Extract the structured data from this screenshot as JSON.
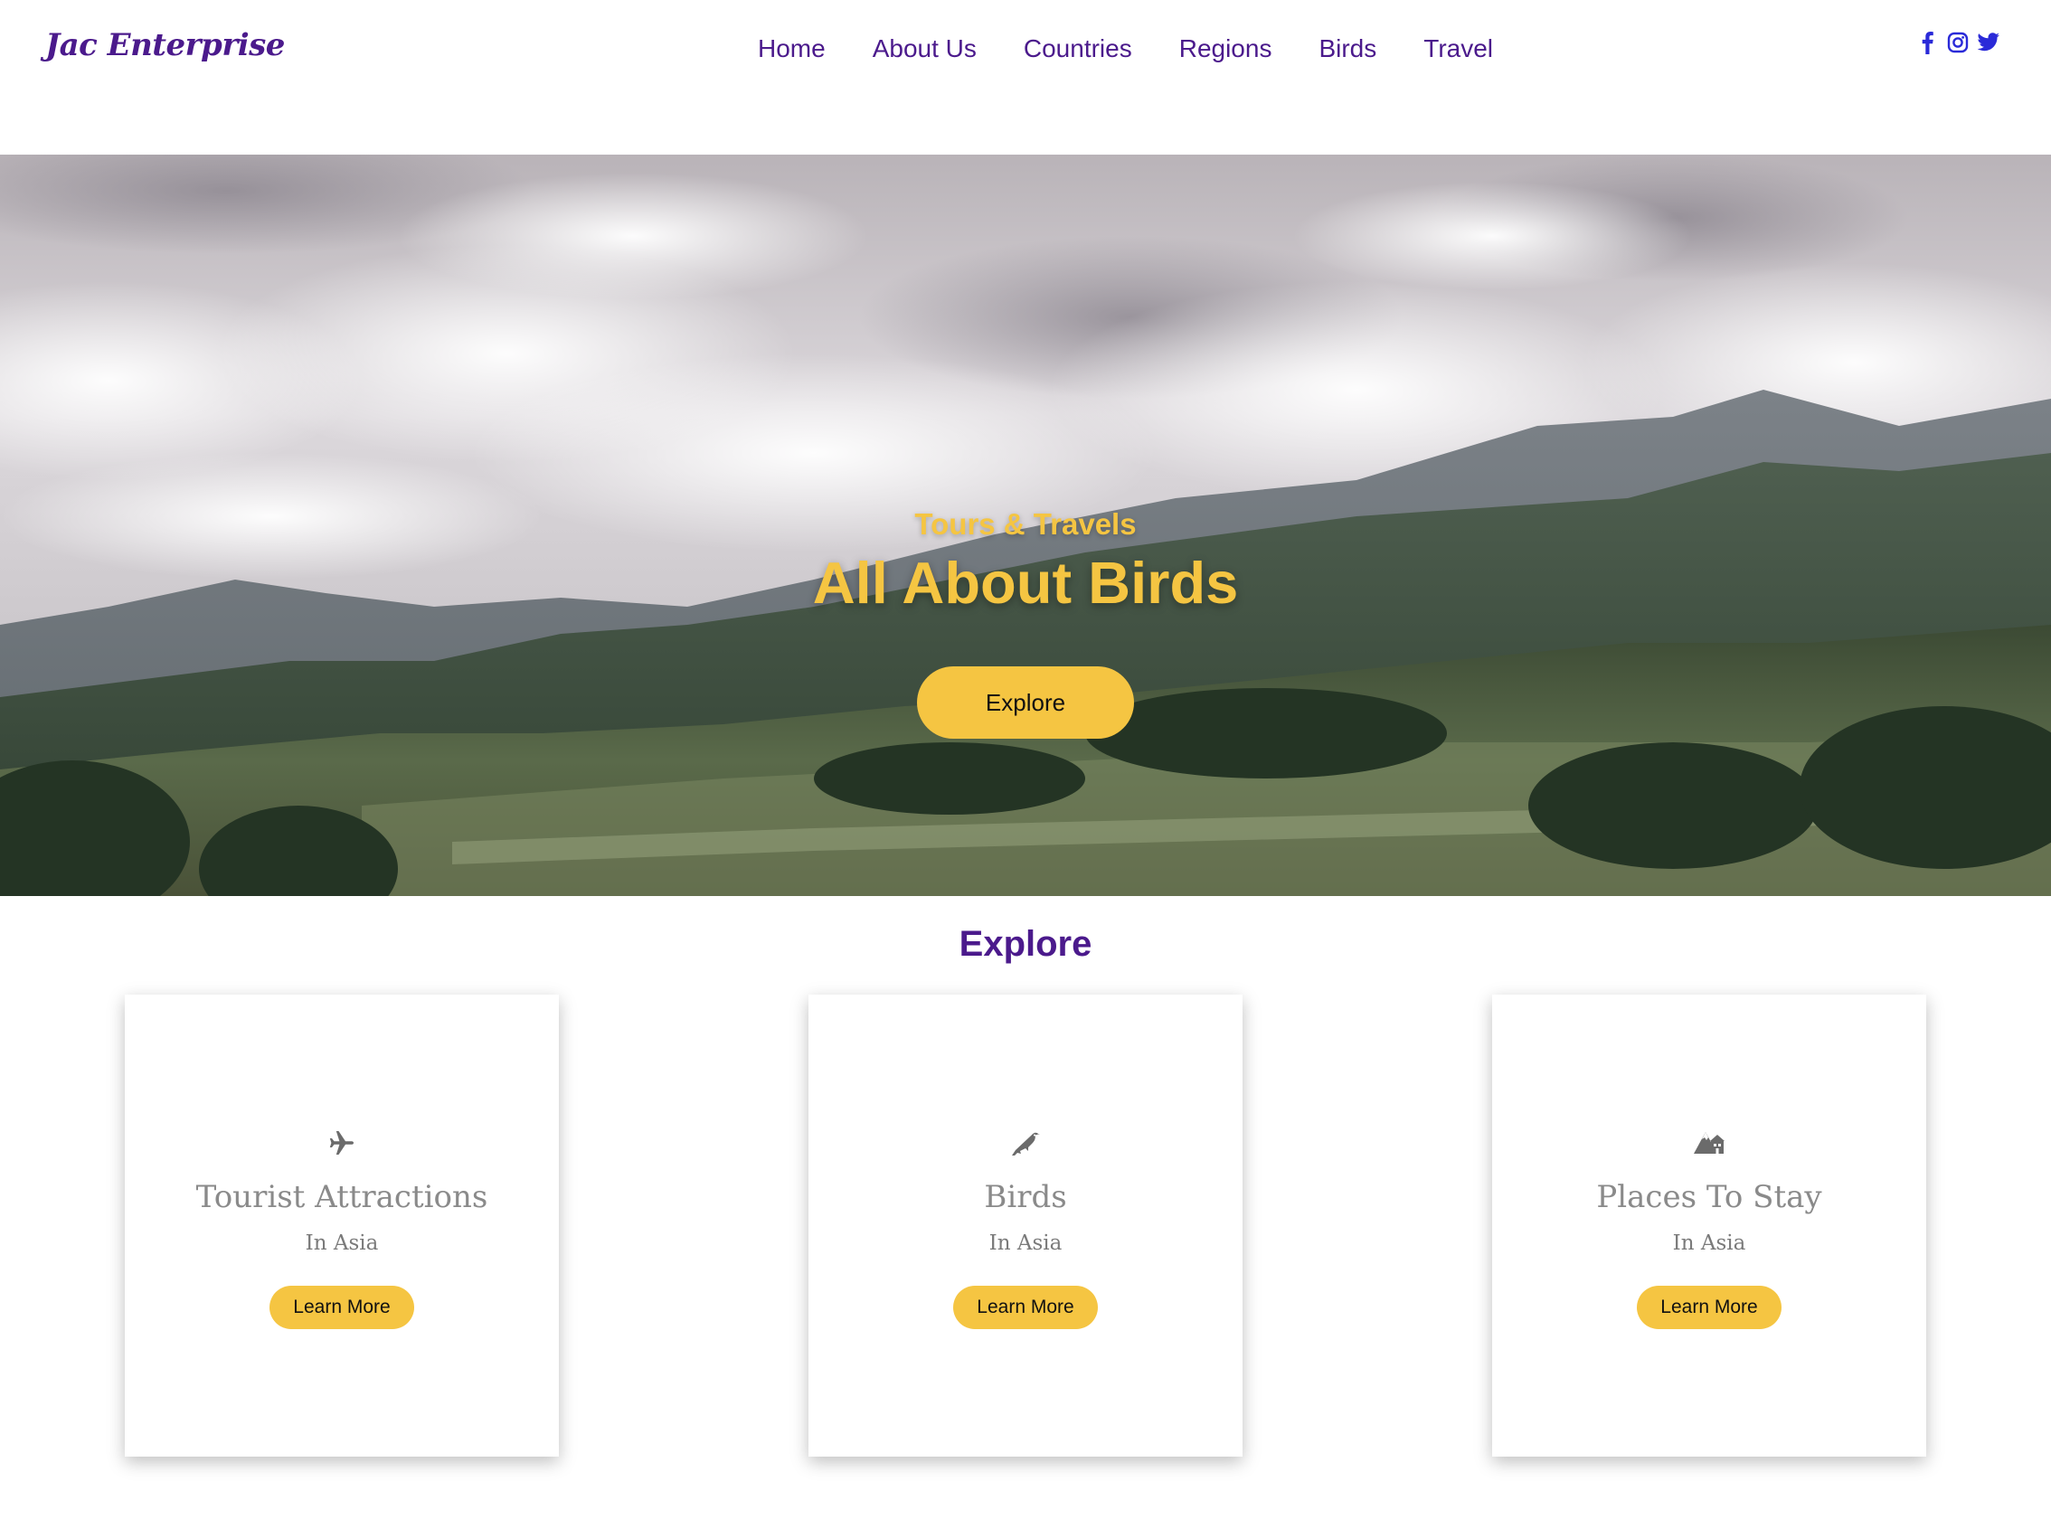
{
  "brand": {
    "logo_text": "Jac Enterprise"
  },
  "nav": {
    "items": [
      {
        "label": "Home"
      },
      {
        "label": "About Us"
      },
      {
        "label": "Countries"
      },
      {
        "label": "Regions"
      },
      {
        "label": "Birds"
      },
      {
        "label": "Travel"
      }
    ]
  },
  "social": {
    "icons": [
      "facebook-icon",
      "instagram-icon",
      "twitter-icon"
    ],
    "color": "#2a2ad8"
  },
  "hero": {
    "subtitle": "Tours & Travels",
    "title": "All About Birds",
    "button_label": "Explore",
    "accent_color": "#f5c542"
  },
  "explore": {
    "title": "Explore",
    "cards": [
      {
        "icon": "plane-icon",
        "title": "Tourist Attractions",
        "subtitle": "In Asia",
        "button_label": "Learn More"
      },
      {
        "icon": "bird-icon",
        "title": "Birds",
        "subtitle": "In Asia",
        "button_label": "Learn More"
      },
      {
        "icon": "mountain-icon",
        "title": "Places To Stay",
        "subtitle": "In Asia",
        "button_label": "Learn More"
      }
    ]
  },
  "colors": {
    "brand_purple": "#4b1a8c",
    "button_yellow": "#f5c542"
  }
}
